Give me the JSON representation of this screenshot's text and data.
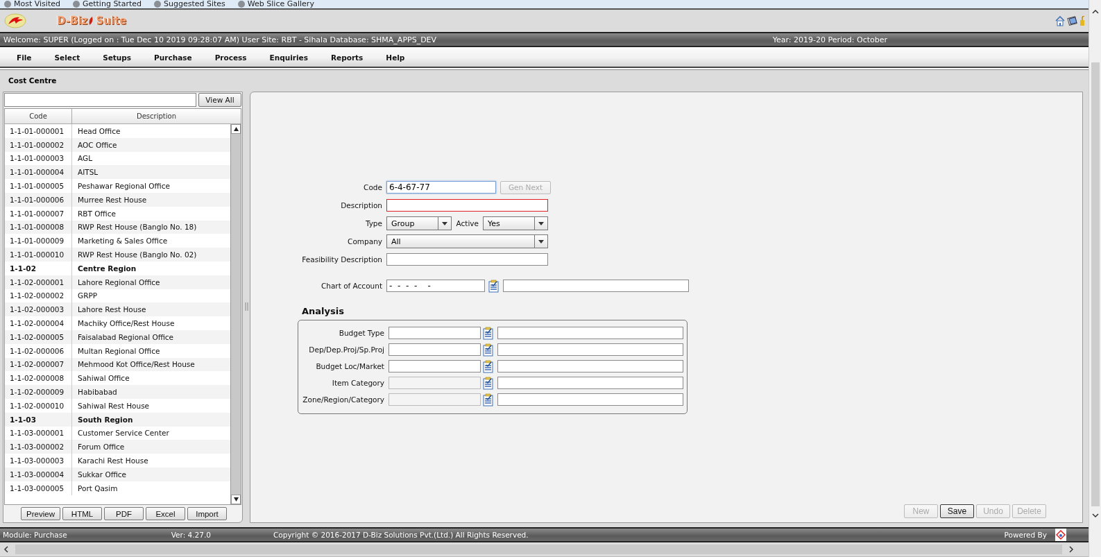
{
  "browser_bookmarks": [
    "Most Visited",
    "Getting Started",
    "Suggested Sites",
    "Web Slice Gallery"
  ],
  "app": {
    "logo_text": [
      "D-Biz",
      "Suite"
    ]
  },
  "welcome_bar": {
    "session": "Welcome: SUPER (Logged on : Tue Dec 10 2019 09:28:07 AM) User Site: RBT - Sihala Database: SHMA_APPS_DEV",
    "period": "Year: 2019-20 Period: October"
  },
  "menu": [
    "File",
    "Select",
    "Setups",
    "Purchase",
    "Process",
    "Enquiries",
    "Reports",
    "Help"
  ],
  "page_title": "Cost Centre",
  "list": {
    "view_all": "View All",
    "columns": [
      "Code",
      "Description"
    ],
    "rows": [
      {
        "code": "1-1-01-000001",
        "description": "Head Office",
        "kind": "item"
      },
      {
        "code": "1-1-01-000002",
        "description": "AOC Office",
        "kind": "item"
      },
      {
        "code": "1-1-01-000003",
        "description": "AGL",
        "kind": "item"
      },
      {
        "code": "1-1-01-000004",
        "description": "AITSL",
        "kind": "item"
      },
      {
        "code": "1-1-01-000005",
        "description": "Peshawar Regional Office",
        "kind": "item"
      },
      {
        "code": "1-1-01-000006",
        "description": "Murree Rest House",
        "kind": "item"
      },
      {
        "code": "1-1-01-000007",
        "description": "RBT Office",
        "kind": "item"
      },
      {
        "code": "1-1-01-000008",
        "description": "RWP Rest House (Banglo No. 18)",
        "kind": "item"
      },
      {
        "code": "1-1-01-000009",
        "description": "Marketing & Sales Office",
        "kind": "item"
      },
      {
        "code": "1-1-01-000010",
        "description": "RWP Rest House (Banglo No. 02)",
        "kind": "item"
      },
      {
        "code": "1-1-02",
        "description": "Centre Region",
        "kind": "group"
      },
      {
        "code": "1-1-02-000001",
        "description": "Lahore Regional Office",
        "kind": "item"
      },
      {
        "code": "1-1-02-000002",
        "description": "GRPP",
        "kind": "item"
      },
      {
        "code": "1-1-02-000003",
        "description": "Lahore Rest House",
        "kind": "item"
      },
      {
        "code": "1-1-02-000004",
        "description": "Machiky Office/Rest House",
        "kind": "item"
      },
      {
        "code": "1-1-02-000005",
        "description": "Faisalabad Regional Office",
        "kind": "item"
      },
      {
        "code": "1-1-02-000006",
        "description": "Multan Regional Office",
        "kind": "item"
      },
      {
        "code": "1-1-02-000007",
        "description": "Mehmood Kot Office/Rest House",
        "kind": "item"
      },
      {
        "code": "1-1-02-000008",
        "description": "Sahiwal Office",
        "kind": "item"
      },
      {
        "code": "1-1-02-000009",
        "description": "Habibabad",
        "kind": "item"
      },
      {
        "code": "1-1-02-000010",
        "description": "Sahiwal Rest House",
        "kind": "item"
      },
      {
        "code": "1-1-03",
        "description": "South Region",
        "kind": "group"
      },
      {
        "code": "1-1-03-000001",
        "description": "Customer Service Center",
        "kind": "item"
      },
      {
        "code": "1-1-03-000002",
        "description": "Forum Office",
        "kind": "item"
      },
      {
        "code": "1-1-03-000003",
        "description": "Karachi Rest House",
        "kind": "item"
      },
      {
        "code": "1-1-03-000004",
        "description": "Sukkar Office",
        "kind": "item"
      },
      {
        "code": "1-1-03-000005",
        "description": "Port Qasim",
        "kind": "item"
      }
    ],
    "export_buttons": [
      "Preview",
      "HTML",
      "PDF",
      "Excel",
      "Import"
    ]
  },
  "form": {
    "code": {
      "label": "Code",
      "value": "6-4-67-77",
      "focused": true
    },
    "gen_next": {
      "label": "Gen Next",
      "disabled": true
    },
    "description": {
      "label": "Description",
      "invalid": true
    },
    "type": {
      "label": "Type",
      "value": "Group"
    },
    "active": {
      "label": "Active",
      "value": "Yes"
    },
    "company": {
      "label": "Company",
      "value": "All"
    },
    "feasibility": {
      "label": "Feasibility Description"
    },
    "chart_of_account": {
      "label": "Chart of Account",
      "value": "-  -  -  -    -"
    },
    "analysis": {
      "title": "Analysis",
      "rows": [
        {
          "label": "Budget Type",
          "disabled": false
        },
        {
          "label": "Dep/Dep.Proj/Sp.Proj",
          "disabled": false
        },
        {
          "label": "Budget Loc/Market",
          "disabled": false
        },
        {
          "label": "Item Category",
          "disabled": true
        },
        {
          "label": "Zone/Region/Category",
          "disabled": true
        }
      ]
    }
  },
  "actions": [
    {
      "label": "New",
      "disabled": true
    },
    {
      "label": "Save",
      "disabled": false
    },
    {
      "label": "Undo",
      "disabled": true
    },
    {
      "label": "Delete",
      "disabled": true
    }
  ],
  "status_bar": {
    "module": "Module: Purchase",
    "version": "Ver: 4.27.0",
    "copyright": "Copyright © 2016-2017 D-Biz Solutions Pvt.(Ltd.) All Rights Reserved.",
    "powered_by": "Powered By"
  }
}
